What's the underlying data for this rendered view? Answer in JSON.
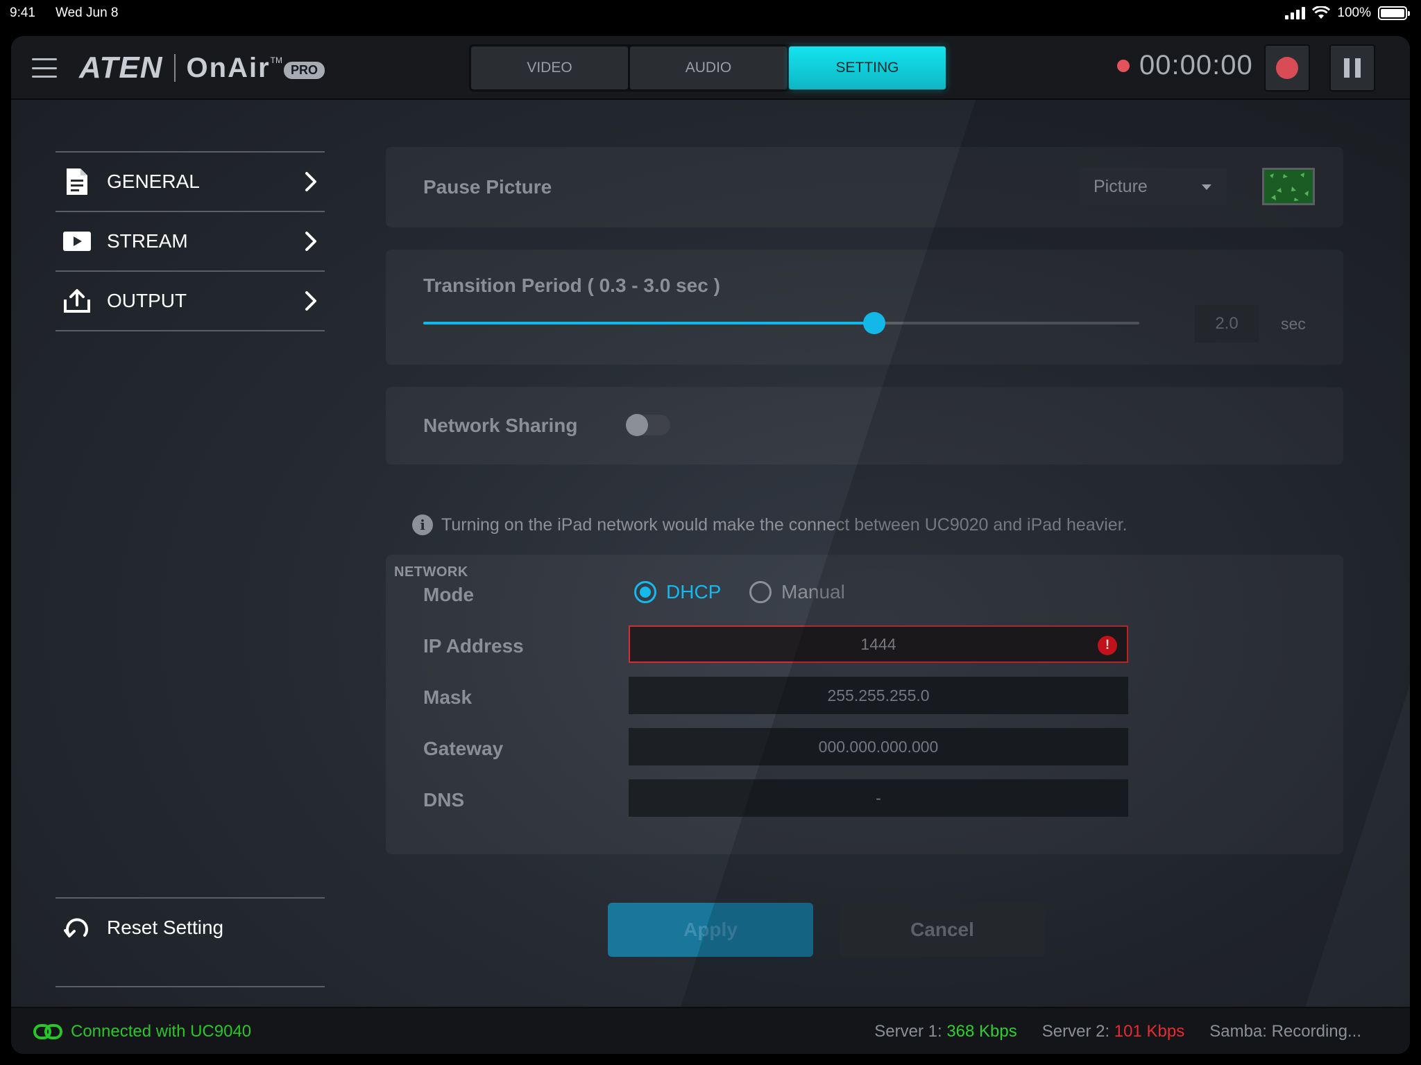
{
  "status_bar": {
    "time": "9:41",
    "date": "Wed Jun 8",
    "battery": "100%"
  },
  "header": {
    "brand": "ATEN",
    "product": "OnAir",
    "trademark": "TM",
    "badge": "PRO",
    "tabs": [
      {
        "label": "VIDEO",
        "active": false
      },
      {
        "label": "AUDIO",
        "active": false
      },
      {
        "label": "SETTING",
        "active": true
      }
    ],
    "timer": "00:00:00"
  },
  "sidebar": {
    "items": [
      {
        "label": "GENERAL",
        "icon": "document-icon"
      },
      {
        "label": "STREAM",
        "icon": "play-icon"
      },
      {
        "label": "OUTPUT",
        "icon": "upload-icon"
      }
    ],
    "reset_label": "Reset Setting"
  },
  "pause_picture": {
    "label": "Pause Picture",
    "select_value": "Picture"
  },
  "transition": {
    "label": "Transition Period ( 0.3 - 3.0 sec )",
    "min": 0.3,
    "max": 3.0,
    "value": 2.0,
    "value_text": "2.0",
    "unit": "sec"
  },
  "network_sharing": {
    "label": "Network Sharing",
    "enabled": false,
    "note": "Turning on the iPad network would make the connect between UC9020 and iPad heavier."
  },
  "network": {
    "section_title": "NETWORK",
    "mode_label": "Mode",
    "modes": [
      {
        "label": "DHCP",
        "selected": true
      },
      {
        "label": "Manual",
        "selected": false
      }
    ],
    "ip_label": "IP Address",
    "ip_value": "1444",
    "ip_error": true,
    "mask_label": "Mask",
    "mask_value": "255.255.255.0",
    "gateway_label": "Gateway",
    "gateway_value": "000.000.000.000",
    "dns_label": "DNS",
    "dns_value": "-"
  },
  "actions": {
    "apply": "Apply",
    "cancel": "Cancel"
  },
  "footer": {
    "connection": "Connected with UC9040",
    "server1_label": "Server 1:",
    "server1_value": "368 Kbps",
    "server2_label": "Server 2:",
    "server2_value": "101 Kbps",
    "samba": "Samba: Recording..."
  },
  "colors": {
    "accent": "#14e3ef",
    "slider": "#14b8e8",
    "error": "#e5161f",
    "ok": "#29c62a"
  }
}
